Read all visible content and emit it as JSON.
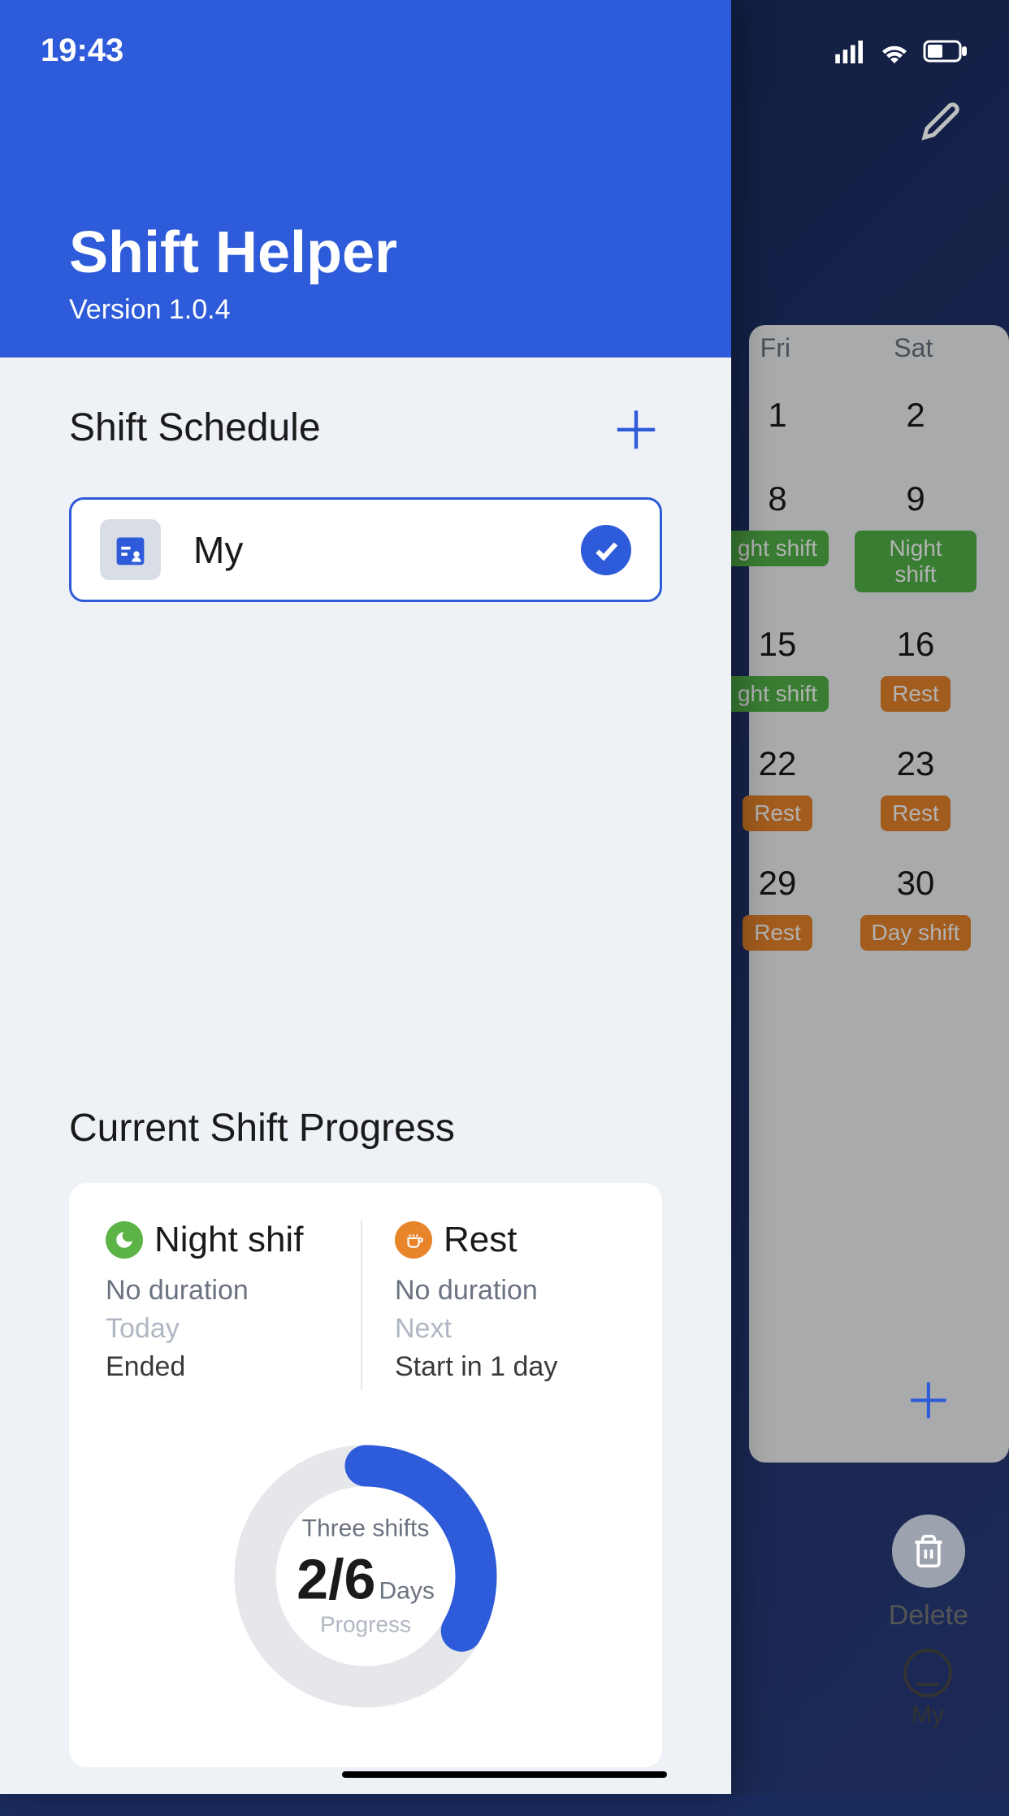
{
  "status": {
    "time": "19:43"
  },
  "app": {
    "title": "Shift Helper",
    "version": "Version 1.0.4"
  },
  "schedule_section": {
    "title": "Shift Schedule",
    "items": [
      {
        "name": "My",
        "selected": true
      }
    ]
  },
  "progress_section": {
    "title": "Current Shift Progress",
    "shifts": [
      {
        "name": "Night shif",
        "duration": "No duration",
        "timing": "Today",
        "status": "Ended",
        "color": "green"
      },
      {
        "name": "Rest",
        "duration": "No duration",
        "timing": "Next",
        "status": "Start in 1 day",
        "color": "orange"
      }
    ],
    "ring": {
      "top_label": "Three shifts",
      "current": "2",
      "separator": "/",
      "total": "6",
      "unit": "Days",
      "bottom_label": "Progress"
    }
  },
  "background": {
    "delete_label": "Delete",
    "my_label": "My",
    "calendar": {
      "headers": [
        "Fri",
        "Sat"
      ],
      "rows": [
        {
          "dates": [
            "1",
            "2"
          ],
          "badges": [
            "",
            ""
          ]
        },
        {
          "dates": [
            "8",
            "9"
          ],
          "badges": [
            "ght shift",
            "Night shift"
          ],
          "colors": [
            "green",
            "green"
          ]
        },
        {
          "dates": [
            "15",
            "16"
          ],
          "badges": [
            "ght shift",
            "Rest"
          ],
          "colors": [
            "green",
            "orange"
          ]
        },
        {
          "dates": [
            "22",
            "23"
          ],
          "badges": [
            "Rest",
            "Rest"
          ],
          "colors": [
            "orange",
            "orange"
          ]
        },
        {
          "dates": [
            "29",
            "30"
          ],
          "badges": [
            "Rest",
            "Day shift"
          ],
          "colors": [
            "orange",
            "orange"
          ]
        }
      ]
    }
  }
}
